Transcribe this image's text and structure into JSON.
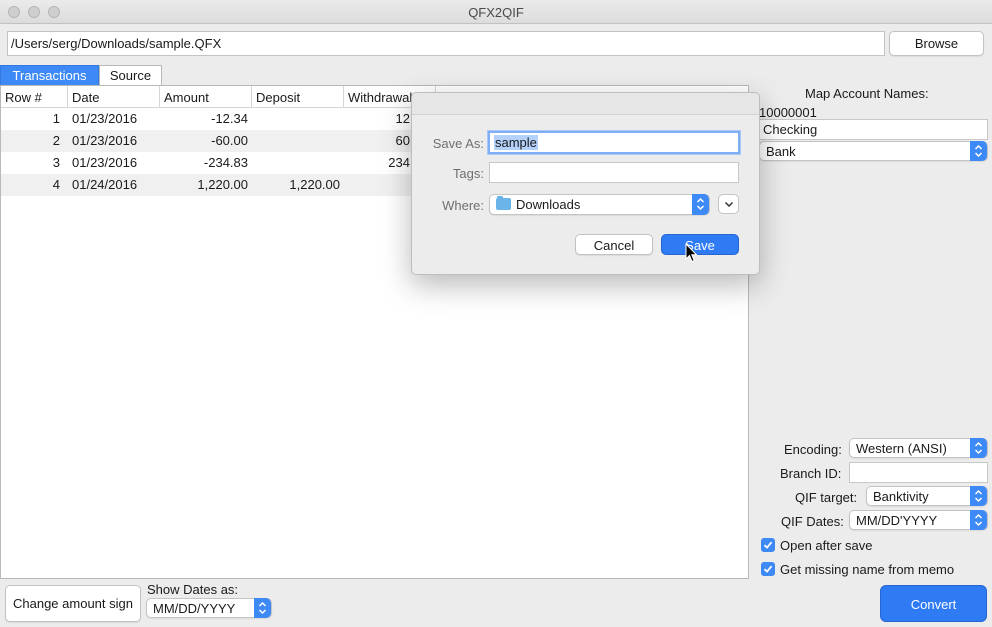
{
  "window": {
    "title": "QFX2QIF"
  },
  "path": {
    "value": "/Users/serg/Downloads/sample.QFX"
  },
  "browse_label": "Browse",
  "tabs": [
    {
      "label": "Transactions",
      "active": true
    },
    {
      "label": "Source",
      "active": false
    }
  ],
  "table": {
    "columns": [
      "Row #",
      "Date",
      "Amount",
      "Deposit",
      "Withdrawal"
    ],
    "rows": [
      {
        "row": "1",
        "date": "01/23/2016",
        "amount": "-12.34",
        "deposit": "",
        "withdrawal": "12"
      },
      {
        "row": "2",
        "date": "01/23/2016",
        "amount": "-60.00",
        "deposit": "",
        "withdrawal": "60"
      },
      {
        "row": "3",
        "date": "01/23/2016",
        "amount": "-234.83",
        "deposit": "",
        "withdrawal": "234"
      },
      {
        "row": "4",
        "date": "01/24/2016",
        "amount": "1,220.00",
        "deposit": "1,220.00",
        "withdrawal": ""
      }
    ]
  },
  "side": {
    "map_title": "Map Account Names:",
    "account_id": "10000001",
    "account_name": "Checking",
    "account_type": "Bank",
    "encoding_label": "Encoding:",
    "encoding_value": "Western (ANSI)",
    "branch_label": "Branch ID:",
    "branch_value": "",
    "qif_target_label": "QIF target:",
    "qif_target_value": "Banktivity",
    "qif_dates_label": "QIF Dates:",
    "qif_dates_value": "MM/DD'YYYY",
    "open_after_save": "Open after save",
    "missing_name": "Get missing name from memo"
  },
  "bottom": {
    "change_sign_label": "Change amount sign",
    "show_dates_label": "Show Dates as:",
    "show_dates_value": "MM/DD/YYYY",
    "convert_label": "Convert"
  },
  "dialog": {
    "save_as_label": "Save As:",
    "save_as_value": "sample",
    "tags_label": "Tags:",
    "tags_value": "",
    "where_label": "Where:",
    "where_value": "Downloads",
    "cancel_label": "Cancel",
    "save_label": "Save"
  },
  "colors": {
    "accent": "#3d8af7",
    "button_primary": "#2f7bf4",
    "selection": "#b3d1fb"
  }
}
